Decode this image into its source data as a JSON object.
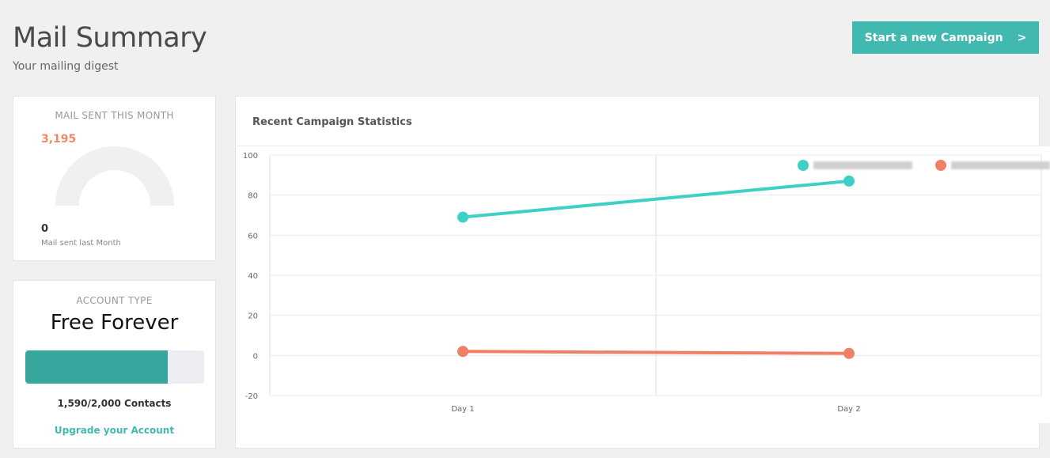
{
  "header": {
    "title": "Mail Summary",
    "subtitle": "Your mailing digest",
    "cta_label": "Start a new Campaign",
    "cta_chevron": ">"
  },
  "mail_card": {
    "heading": "MAIL SENT THIS MONTH",
    "value": "3,195",
    "gauge_fraction": 0,
    "last_month_value": "0",
    "last_month_label": "Mail sent last Month"
  },
  "account_card": {
    "heading": "ACCOUNT TYPE",
    "type": "Free Forever",
    "contacts_text": "1,590/2,000 Contacts",
    "contacts_used": 1590,
    "contacts_limit": 2000,
    "upgrade_label": "Upgrade your Account"
  },
  "chart_panel": {
    "title": "Recent Campaign Statistics"
  },
  "colors": {
    "teal": "#3ecfc6",
    "coral": "#f07f66",
    "button": "#42b9b0",
    "progress": "#37a79e"
  },
  "chart_data": {
    "type": "line",
    "categories": [
      "Day 1",
      "Day 2"
    ],
    "ylim": [
      -20,
      100
    ],
    "yticks": [
      100,
      80,
      60,
      40,
      20,
      0,
      -20
    ],
    "grid": true,
    "legend_position": "top-right",
    "series": [
      {
        "values": [
          69,
          87
        ],
        "color": "#3ecfc6"
      },
      {
        "values": [
          2,
          1
        ],
        "color": "#f07f66"
      }
    ]
  }
}
